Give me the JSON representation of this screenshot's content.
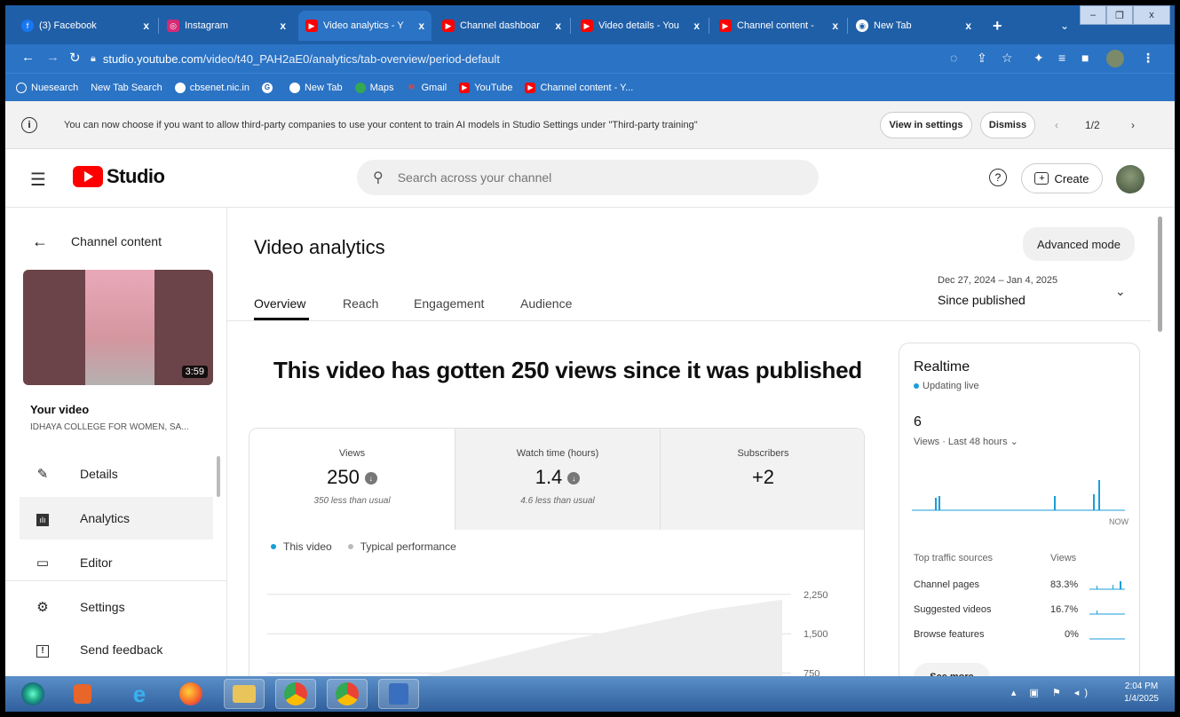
{
  "browser": {
    "tabs": [
      {
        "title": "(3) Facebook",
        "icon": "facebook-icon",
        "color": "#1877f2"
      },
      {
        "title": "Instagram",
        "icon": "instagram-icon",
        "color": "#d62976"
      },
      {
        "title": "Video analytics - Y",
        "icon": "youtube-icon",
        "color": "#ff0000",
        "active": true
      },
      {
        "title": "Channel dashboar",
        "icon": "youtube-icon",
        "color": "#ff0000"
      },
      {
        "title": "Video details - You",
        "icon": "youtube-icon",
        "color": "#ff0000"
      },
      {
        "title": "Channel content -",
        "icon": "youtube-icon",
        "color": "#ff0000"
      },
      {
        "title": "New Tab",
        "icon": "chrome-icon",
        "color": "#ffffff"
      }
    ],
    "new_tab_symbol": "+",
    "tab_close_symbol": "x",
    "url_host": "studio.youtube.com",
    "url_path": "/video/t40_PAH2aE0/analytics/tab-overview/period-default",
    "bookmarks": [
      {
        "label": "Nuesearch"
      },
      {
        "label": "New Tab Search"
      },
      {
        "label": "cbsenet.nic.in"
      },
      {
        "label": ""
      },
      {
        "label": "New Tab"
      },
      {
        "label": "Maps"
      },
      {
        "label": "Gmail"
      },
      {
        "label": "YouTube"
      },
      {
        "label": "Channel content - Y..."
      }
    ]
  },
  "banner": {
    "message": "You can now choose if you want to allow third-party companies to use your content to train AI models in Studio Settings under \"Third-party training\"",
    "view_settings": "View in settings",
    "dismiss": "Dismiss",
    "pager": "1/2"
  },
  "header": {
    "logo_text": "Studio",
    "search_placeholder": "Search across your channel",
    "create_label": "Create"
  },
  "sidebar": {
    "back_title": "Channel content",
    "thumb_duration": "3:59",
    "your_video_label": "Your video",
    "channel_name": "IDHAYA COLLEGE FOR WOMEN, SA...",
    "items": [
      {
        "label": "Details",
        "icon": "pencil-icon"
      },
      {
        "label": "Analytics",
        "icon": "analytics-icon",
        "active": true
      },
      {
        "label": "Editor",
        "icon": "editor-icon"
      },
      {
        "label": "Settings",
        "icon": "gear-icon"
      },
      {
        "label": "Send feedback",
        "icon": "feedback-icon"
      }
    ]
  },
  "main": {
    "title": "Video analytics",
    "advanced_mode": "Advanced mode",
    "tabs": [
      {
        "label": "Overview",
        "active": true
      },
      {
        "label": "Reach"
      },
      {
        "label": "Engagement"
      },
      {
        "label": "Audience"
      }
    ],
    "date_range": "Dec 27, 2024 – Jan 4, 2025",
    "period": "Since published",
    "headline": "This video has gotten 250 views since it was published",
    "stats": [
      {
        "label": "Views",
        "value": "250",
        "note": "350 less than usual"
      },
      {
        "label": "Watch time (hours)",
        "value": "1.4",
        "note": "4.6 less than usual"
      },
      {
        "label": "Subscribers",
        "value": "+2",
        "note": ""
      }
    ],
    "legend": {
      "this_video": "This video",
      "typical": "Typical performance"
    },
    "accent_color": "#1a9ed8"
  },
  "chart_data": {
    "type": "area",
    "yticks": [
      "2,250",
      "1,500",
      "750"
    ],
    "series": [
      {
        "name": "This video",
        "values": [
          0,
          80,
          110,
          125,
          135,
          140,
          145,
          150
        ]
      },
      {
        "name": "Typical performance",
        "values": [
          0,
          300,
          650,
          1000,
          1350,
          1650,
          1950,
          2150
        ]
      }
    ]
  },
  "realtime": {
    "title": "Realtime",
    "status": "Updating live",
    "count": "6",
    "period": "Views · Last 48 hours",
    "now_label": "NOW",
    "traffic_header": "Top traffic sources",
    "traffic_views_header": "Views",
    "sources": [
      {
        "label": "Channel pages",
        "value": "83.3%"
      },
      {
        "label": "Suggested videos",
        "value": "16.7%"
      },
      {
        "label": "Browse features",
        "value": "0%"
      }
    ],
    "see_more": "See more"
  },
  "taskbar": {
    "time": "2:04 PM",
    "date": "1/4/2025"
  }
}
